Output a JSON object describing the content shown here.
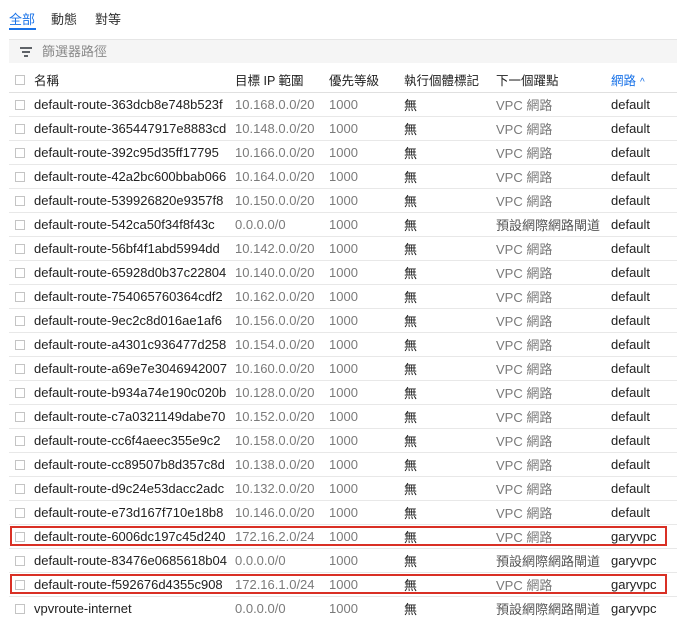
{
  "tabs": [
    {
      "label": "全部"
    },
    {
      "label": "動態"
    },
    {
      "label": "對等"
    }
  ],
  "filter": {
    "placeholder": "篩選器路徑"
  },
  "columns": {
    "name": "名稱",
    "dest": "目標 IP 範圍",
    "priority": "優先等級",
    "tags": "執行個體標記",
    "next_hop": "下一個躍點",
    "network": "網路",
    "sort_indicator": "^"
  },
  "rows": [
    {
      "name": "default-route-363dcb8e748b523f",
      "dest": "10.168.0.0/20",
      "priority": "1000",
      "tags": "無",
      "next_hop": "VPC 網路",
      "network": "default"
    },
    {
      "name": "default-route-365447917e8883cd",
      "dest": "10.148.0.0/20",
      "priority": "1000",
      "tags": "無",
      "next_hop": "VPC 網路",
      "network": "default"
    },
    {
      "name": "default-route-392c95d35ff17795",
      "dest": "10.166.0.0/20",
      "priority": "1000",
      "tags": "無",
      "next_hop": "VPC 網路",
      "network": "default"
    },
    {
      "name": "default-route-42a2bc600bbab066",
      "dest": "10.164.0.0/20",
      "priority": "1000",
      "tags": "無",
      "next_hop": "VPC 網路",
      "network": "default"
    },
    {
      "name": "default-route-539926820e9357f8",
      "dest": "10.150.0.0/20",
      "priority": "1000",
      "tags": "無",
      "next_hop": "VPC 網路",
      "network": "default"
    },
    {
      "name": "default-route-542ca50f34f8f43c",
      "dest": "0.0.0.0/0",
      "priority": "1000",
      "tags": "無",
      "next_hop": "預設網際網路閘道",
      "network": "default"
    },
    {
      "name": "default-route-56bf4f1abd5994dd",
      "dest": "10.142.0.0/20",
      "priority": "1000",
      "tags": "無",
      "next_hop": "VPC 網路",
      "network": "default"
    },
    {
      "name": "default-route-65928d0b37c22804",
      "dest": "10.140.0.0/20",
      "priority": "1000",
      "tags": "無",
      "next_hop": "VPC 網路",
      "network": "default"
    },
    {
      "name": "default-route-754065760364cdf2",
      "dest": "10.162.0.0/20",
      "priority": "1000",
      "tags": "無",
      "next_hop": "VPC 網路",
      "network": "default"
    },
    {
      "name": "default-route-9ec2c8d016ae1af6",
      "dest": "10.156.0.0/20",
      "priority": "1000",
      "tags": "無",
      "next_hop": "VPC 網路",
      "network": "default"
    },
    {
      "name": "default-route-a4301c936477d258",
      "dest": "10.154.0.0/20",
      "priority": "1000",
      "tags": "無",
      "next_hop": "VPC 網路",
      "network": "default"
    },
    {
      "name": "default-route-a69e7e3046942007",
      "dest": "10.160.0.0/20",
      "priority": "1000",
      "tags": "無",
      "next_hop": "VPC 網路",
      "network": "default"
    },
    {
      "name": "default-route-b934a74e190c020b",
      "dest": "10.128.0.0/20",
      "priority": "1000",
      "tags": "無",
      "next_hop": "VPC 網路",
      "network": "default"
    },
    {
      "name": "default-route-c7a0321149dabe70",
      "dest": "10.152.0.0/20",
      "priority": "1000",
      "tags": "無",
      "next_hop": "VPC 網路",
      "network": "default"
    },
    {
      "name": "default-route-cc6f4aeec355e9c2",
      "dest": "10.158.0.0/20",
      "priority": "1000",
      "tags": "無",
      "next_hop": "VPC 網路",
      "network": "default"
    },
    {
      "name": "default-route-cc89507b8d357c8d",
      "dest": "10.138.0.0/20",
      "priority": "1000",
      "tags": "無",
      "next_hop": "VPC 網路",
      "network": "default"
    },
    {
      "name": "default-route-d9c24e53dacc2adc",
      "dest": "10.132.0.0/20",
      "priority": "1000",
      "tags": "無",
      "next_hop": "VPC 網路",
      "network": "default"
    },
    {
      "name": "default-route-e73d167f710e18b8",
      "dest": "10.146.0.0/20",
      "priority": "1000",
      "tags": "無",
      "next_hop": "VPC 網路",
      "network": "default"
    },
    {
      "name": "default-route-6006dc197c45d240",
      "dest": "172.16.2.0/24",
      "priority": "1000",
      "tags": "無",
      "next_hop": "VPC 網路",
      "network": "garyvpc",
      "highlighted": true
    },
    {
      "name": "default-route-83476e0685618b04",
      "dest": "0.0.0.0/0",
      "priority": "1000",
      "tags": "無",
      "next_hop": "預設網際網路閘道",
      "network": "garyvpc"
    },
    {
      "name": "default-route-f592676d4355c908",
      "dest": "172.16.1.0/24",
      "priority": "1000",
      "tags": "無",
      "next_hop": "VPC 網路",
      "network": "garyvpc",
      "highlighted": true
    },
    {
      "name": "vpvroute-internet",
      "dest": "0.0.0.0/0",
      "priority": "1000",
      "tags": "無",
      "next_hop": "預設網際網路閘道",
      "network": "garyvpc"
    }
  ],
  "colors": {
    "accent": "#1a73e8",
    "highlight_border": "#d93025"
  }
}
